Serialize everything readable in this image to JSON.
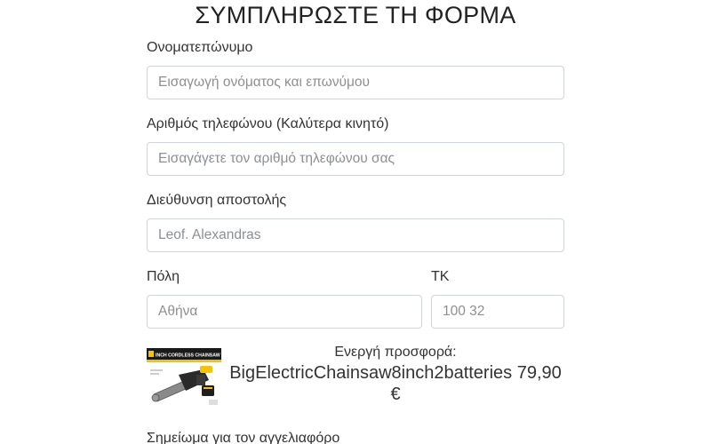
{
  "form": {
    "title": "ΣΥΜΠΛΗΡΩΣΤΕ ΤΗ ΦΟΡΜΑ",
    "full_name": {
      "label": "Ονοματεπώνυμο",
      "placeholder": "Εισαγωγή ονόματος και επωνύμου",
      "value": ""
    },
    "phone": {
      "label": "Αριθμός τηλεφώνου (Καλύτερα κινητό)",
      "placeholder": "Εισαγάγετε τον αριθμό τηλεφώνου σας",
      "value": ""
    },
    "address": {
      "label": "Διεύθυνση αποστολής",
      "placeholder": "Leof. Alexandras",
      "value": ""
    },
    "city": {
      "label": "Πόλη",
      "placeholder": "Αθήνα",
      "value": ""
    },
    "postal_code": {
      "label": "ΤΚ",
      "placeholder": "100 32",
      "value": ""
    },
    "note": {
      "label": "Σημείωμα για τον αγγελιαφόρο"
    }
  },
  "offer": {
    "caption": "Ενεργή προσφορά:",
    "product": "BigElectricChainsaw8inch2batteries 79,90 €",
    "image_banner_text": "INCH CORDLESS CHAINSAW",
    "colors": {
      "banner": "#1a1a1a",
      "accent": "#f5c400",
      "body": "#2a2a2a",
      "chain": "#8a8a8a"
    }
  },
  "theme": {
    "input_border": "#cfd4da",
    "placeholder": "#8c8f93",
    "text": "#333333"
  }
}
